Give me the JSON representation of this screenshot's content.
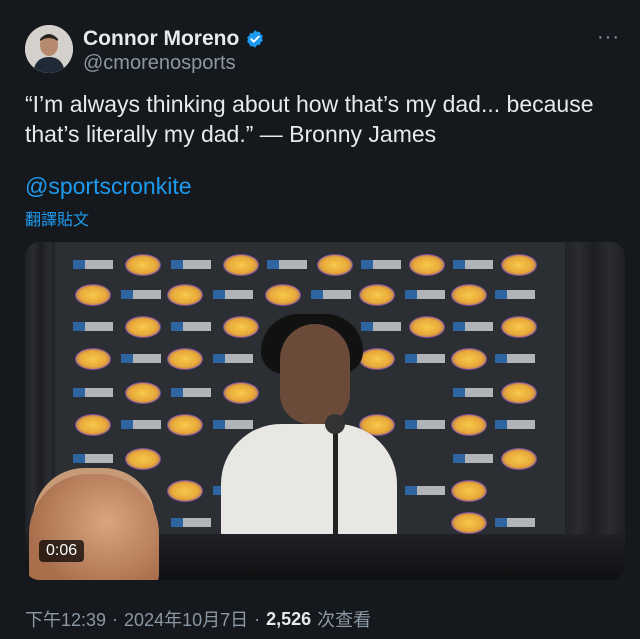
{
  "author": {
    "display_name": "Connor Moreno",
    "handle": "@cmorenosports",
    "verified": true,
    "avatar_icon": "profile-photo"
  },
  "more_label": "···",
  "tweet": {
    "text": "“I’m always thinking about how that’s my dad... because that’s literally my dad.” — Bronny James",
    "mention": "@sportscronkite",
    "translate_label": "翻譯貼文"
  },
  "media": {
    "type": "video",
    "duration": "0:06",
    "backdrop_brands": [
      "UCLA Health",
      "LAKERS"
    ]
  },
  "meta": {
    "time": "下午12:39",
    "date": "2024年10月7日",
    "separator": "·",
    "views_count": "2,526",
    "views_label": "次查看"
  },
  "colors": {
    "background": "#15181c",
    "link": "#1d9bf0",
    "secondary_text": "#8b98a5",
    "verified_badge": "#1d9bf0"
  }
}
